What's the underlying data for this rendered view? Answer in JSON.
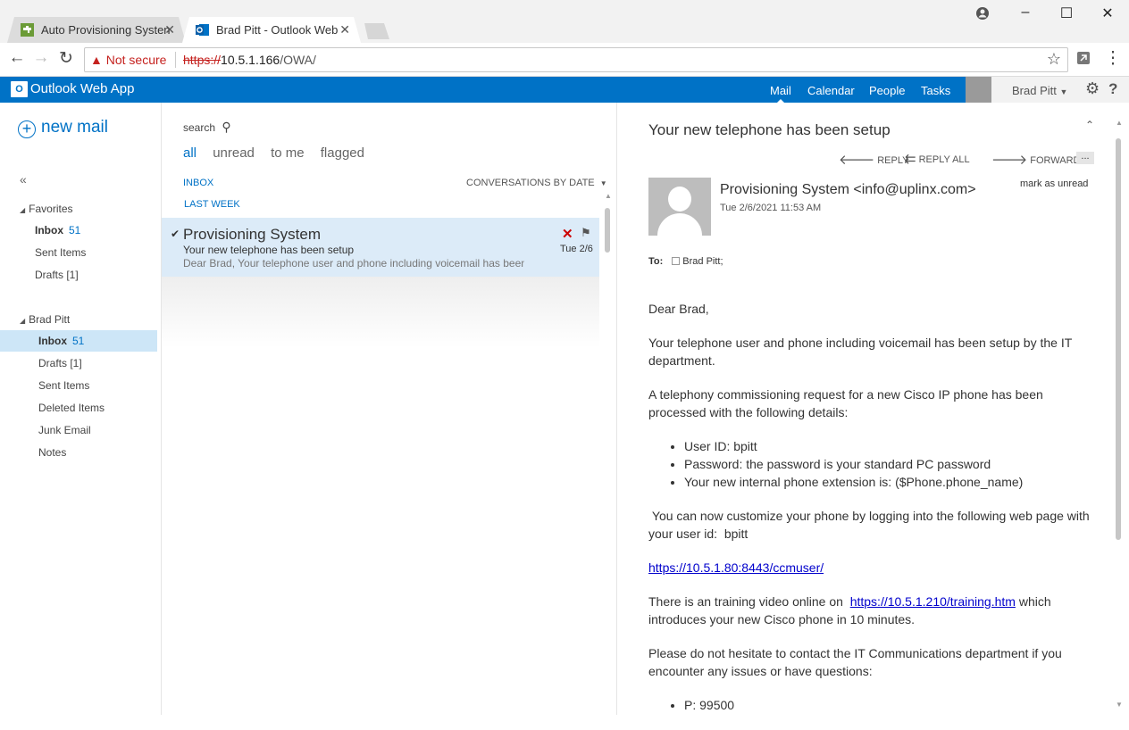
{
  "browser": {
    "tabs": [
      {
        "title": "Auto Provisioning Systen"
      },
      {
        "title": "Brad Pitt - Outlook Web"
      }
    ],
    "not_secure": "Not secure",
    "url_scheme": "https://",
    "url_host": "10.5.1.166",
    "url_path": "/OWA/"
  },
  "owa": {
    "app_name": "Outlook Web App",
    "logo_letter": "O",
    "nav": [
      "Mail",
      "Calendar",
      "People",
      "Tasks"
    ],
    "user_name": "Brad Pitt"
  },
  "folders": {
    "new_mail": "new mail",
    "collapse": "«",
    "favorites_header": "Favorites",
    "favorites": [
      {
        "label": "Inbox",
        "count": "51"
      },
      {
        "label": "Sent Items",
        "count": ""
      },
      {
        "label": "Drafts [1]",
        "count": ""
      }
    ],
    "mailbox_header": "Brad Pitt",
    "mailbox": [
      {
        "label": "Inbox",
        "count": "51"
      },
      {
        "label": "Drafts [1]",
        "count": ""
      },
      {
        "label": "Sent Items",
        "count": ""
      },
      {
        "label": "Deleted Items",
        "count": ""
      },
      {
        "label": "Junk Email",
        "count": ""
      },
      {
        "label": "Notes",
        "count": ""
      }
    ]
  },
  "list": {
    "search_placeholder": "search",
    "filters": [
      "all",
      "unread",
      "to me",
      "flagged"
    ],
    "folder_label": "INBOX",
    "sort_label": "CONVERSATIONS BY DATE",
    "group_label": "LAST WEEK",
    "messages": [
      {
        "sender": "Provisioning System",
        "subject": "Your new telephone has been setup",
        "preview": "Dear Brad,  Your telephone user and phone including voicemail has been setup by the IT department.",
        "date": "Tue 2/6"
      }
    ]
  },
  "reading": {
    "subject": "Your new telephone has been setup",
    "actions": {
      "reply": "REPLY",
      "reply_all": "REPLY ALL",
      "forward": "FORWARD",
      "more": "..."
    },
    "from": "Provisioning System <info@uplinx.com>",
    "date": "Tue 2/6/2021 11:53 AM",
    "mark_unread": "mark as unread",
    "to_label": "To:",
    "to_name": "Brad Pitt;",
    "body": {
      "greeting": "Dear Brad,",
      "p1": "Your telephone user and phone including voicemail has been setup by the IT department.",
      "p2": "A telephony commissioning request for a new Cisco IP phone has been processed with the following details:",
      "details": [
        "User ID: bpitt",
        "Password: the password is your standard PC password",
        "Your new internal phone extension is: ($Phone.phone_name)"
      ],
      "p3": " You can now customize your phone by logging into the following web page with your user id:  bpitt",
      "link1": "https://10.5.1.80:8443/ccmuser/",
      "p4_pre": "There is an training video online on  ",
      "link2": "https://10.5.1.210/training.htm",
      "p4_post": " which introduces your new Cisco phone in 10 minutes.",
      "p5": "Please do not hesitate to contact the IT Communications department if you encounter any issues or have questions:",
      "contacts": [
        "P: 99500"
      ]
    }
  },
  "colors": {
    "owa_blue": "#0072c6",
    "selected_row": "#dcebf8",
    "selected_folder": "#cde6f7",
    "delete_red": "#cc0000",
    "insecure_red": "#c5221f"
  }
}
